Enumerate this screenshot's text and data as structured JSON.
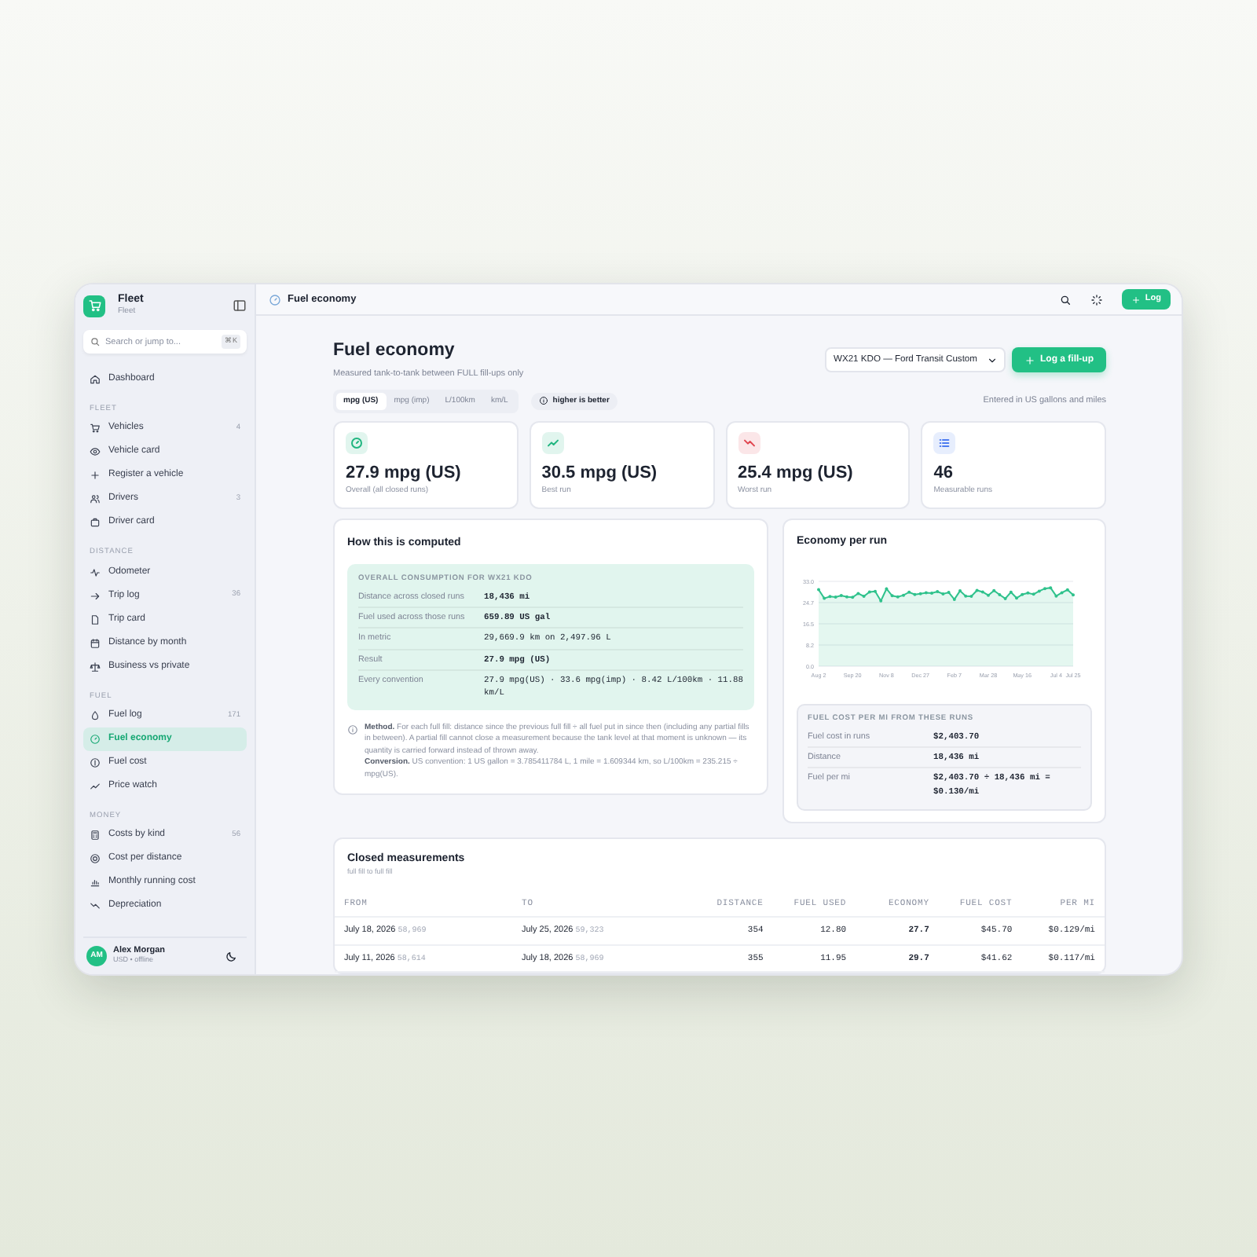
{
  "sidebar": {
    "brand": {
      "name": "Fleet",
      "subtitle": "Fleet"
    },
    "search": {
      "placeholder": "Search or jump to...",
      "shortcut": "⌘K"
    },
    "sections": [
      {
        "items": [
          {
            "label": "Dashboard",
            "selected": false
          }
        ]
      },
      {
        "title": "FLEET",
        "items": [
          {
            "label": "Vehicles",
            "count": "4",
            "selected": false
          },
          {
            "label": "Vehicle card",
            "selected": false
          },
          {
            "label": "Register a vehicle",
            "selected": false
          },
          {
            "label": "Drivers",
            "count": "3",
            "selected": false
          },
          {
            "label": "Driver card",
            "selected": false
          }
        ]
      },
      {
        "title": "DISTANCE",
        "items": [
          {
            "label": "Odometer",
            "selected": false
          },
          {
            "label": "Trip log",
            "count": "36",
            "selected": false
          },
          {
            "label": "Trip card",
            "selected": false
          },
          {
            "label": "Distance by month",
            "selected": false
          },
          {
            "label": "Business vs private",
            "selected": false
          }
        ]
      },
      {
        "title": "FUEL",
        "items": [
          {
            "label": "Fuel log",
            "count": "171",
            "selected": false
          },
          {
            "label": "Fuel economy",
            "selected": true
          },
          {
            "label": "Fuel cost",
            "selected": false
          },
          {
            "label": "Price watch",
            "selected": false
          }
        ]
      },
      {
        "title": "MONEY",
        "items": [
          {
            "label": "Costs by kind",
            "count": "56",
            "selected": false
          },
          {
            "label": "Cost per distance",
            "selected": false
          },
          {
            "label": "Monthly running cost",
            "selected": false
          },
          {
            "label": "Depreciation",
            "selected": false
          }
        ]
      }
    ],
    "user": {
      "initials": "AM",
      "name": "Alex Morgan",
      "meta": "USD • offline"
    }
  },
  "topbar": {
    "title": "Fuel economy",
    "button": "Log"
  },
  "header": {
    "title": "Fuel economy",
    "subtitle": "Measured tank-to-tank between FULL fill-ups only",
    "vehicle": "WX21 KDO — Ford Transit Custom",
    "button": "Log a fill-up"
  },
  "units": [
    {
      "label": "mpg (US)",
      "selected": true
    },
    {
      "label": "mpg (imp)",
      "selected": false
    },
    {
      "label": "L/100km",
      "selected": false
    },
    {
      "label": "km/L",
      "selected": false
    }
  ],
  "hint": "higher is better",
  "note": "Entered in US gallons and miles",
  "stats": [
    {
      "value": "27.9 mpg (US)",
      "label": "Overall (all closed runs)",
      "color": "#1fb57f"
    },
    {
      "value": "30.5 mpg (US)",
      "label": "Best run",
      "color": "#1fb57f"
    },
    {
      "value": "25.4 mpg (US)",
      "label": "Worst run",
      "color": "#e0454f"
    },
    {
      "value": "46",
      "label": "Measurable runs",
      "color": "#4d7cf0"
    }
  ],
  "computed": {
    "title": "How this is computed",
    "box_title": "OVERALL CONSUMPTION FOR WX21 KDO",
    "rows": [
      {
        "label": "Distance across closed runs",
        "value": "18,436 mi",
        "strong": true
      },
      {
        "label": "Fuel used across those runs",
        "value": "659.89 US gal",
        "strong": true
      },
      {
        "label": "In metric",
        "value": "29,669.9 km on 2,497.96 L",
        "strong": false
      },
      {
        "label": "Result",
        "value": "27.9 mpg (US)",
        "strong": true
      },
      {
        "label": "Every convention",
        "value": "27.9 mpg(US) · 33.6 mpg(imp) · 8.42 L/100km · 11.88 km/L",
        "strong": false
      }
    ],
    "method": "**Method.** For each full fill: distance since the previous full fill ÷ all fuel put in since then (including any partial fills in between). A partial fill cannot close a measurement because the tank level at that moment is unknown — its quantity is carried forward instead of thrown away.",
    "conversion": "**Conversion.** US convention: 1 US gallon = 3.785411784 L, 1 mile = 1.609344 km, so L/100km = 235.215 ÷ mpg(US)."
  },
  "economy": {
    "title": "Economy per run",
    "chart_data": {
      "type": "line",
      "grid": true,
      "categories": [
        "Aug 2",
        null,
        null,
        null,
        null,
        null,
        "Sep 20",
        null,
        null,
        null,
        null,
        null,
        "Nov 8",
        null,
        null,
        null,
        null,
        null,
        "Dec 27",
        null,
        null,
        null,
        null,
        null,
        "Feb 7",
        null,
        null,
        null,
        null,
        null,
        "Mar 28",
        null,
        null,
        null,
        null,
        null,
        "May 16",
        null,
        null,
        null,
        null,
        null,
        "Jul 4",
        null,
        null,
        "Jul 25"
      ],
      "ylim": [
        0,
        33
      ],
      "yticks": [
        {
          "value": 0,
          "label": "0.0"
        },
        {
          "value": 8.25,
          "label": "8.2"
        },
        {
          "value": 16.5,
          "label": "16.5"
        },
        {
          "value": 24.75,
          "label": "24.7"
        },
        {
          "value": 33,
          "label": "33.0"
        }
      ],
      "series": [
        {
          "color": "#2fc28c",
          "values": [
            29.8,
            26.4,
            27.1,
            26.9,
            27.5,
            27.0,
            26.8,
            28.3,
            27.2,
            28.9,
            29.1,
            25.4,
            30.1,
            27.4,
            27.0,
            27.6,
            28.8,
            27.9,
            28.2,
            28.6,
            28.4,
            29.0,
            28.1,
            28.7,
            26.0,
            29.3,
            27.3,
            27.2,
            29.5,
            28.9,
            27.6,
            29.4,
            27.8,
            26.3,
            28.8,
            26.5,
            27.9,
            28.5,
            28.0,
            29.2,
            30.2,
            30.5,
            27.3,
            28.6,
            29.7,
            27.7
          ]
        }
      ]
    },
    "cost_title": "FUEL COST PER MI FROM THESE RUNS",
    "cost_rows": [
      {
        "label": "Fuel cost in runs",
        "value": "$2,403.70"
      },
      {
        "label": "Distance",
        "value": "18,436 mi"
      },
      {
        "label": "Fuel per mi",
        "value": "$2,403.70 ÷ 18,436 mi = $0.130/mi"
      }
    ]
  },
  "table": {
    "title": "Closed measurements",
    "subtitle": "full fill to full fill",
    "columns": [
      "FROM",
      "TO",
      "DISTANCE",
      "FUEL USED",
      "ECONOMY",
      "FUEL COST",
      "PER MI"
    ],
    "rows": [
      {
        "cells": [
          {
            "text": "July 18, 2026",
            "odo": "58,969"
          },
          {
            "text": "July 25, 2026",
            "odo": "59,323"
          },
          {
            "text": "354"
          },
          {
            "text": "12.80"
          },
          {
            "text": "27.7"
          },
          {
            "text": "$45.70"
          },
          {
            "text": "$0.129/mi"
          }
        ]
      },
      {
        "cells": [
          {
            "text": "July 11, 2026",
            "odo": "58,614"
          },
          {
            "text": "July 18, 2026",
            "odo": "58,969"
          },
          {
            "text": "355"
          },
          {
            "text": "11.95"
          },
          {
            "text": "29.7"
          },
          {
            "text": "$41.62"
          },
          {
            "text": "$0.117/mi"
          }
        ]
      }
    ]
  }
}
